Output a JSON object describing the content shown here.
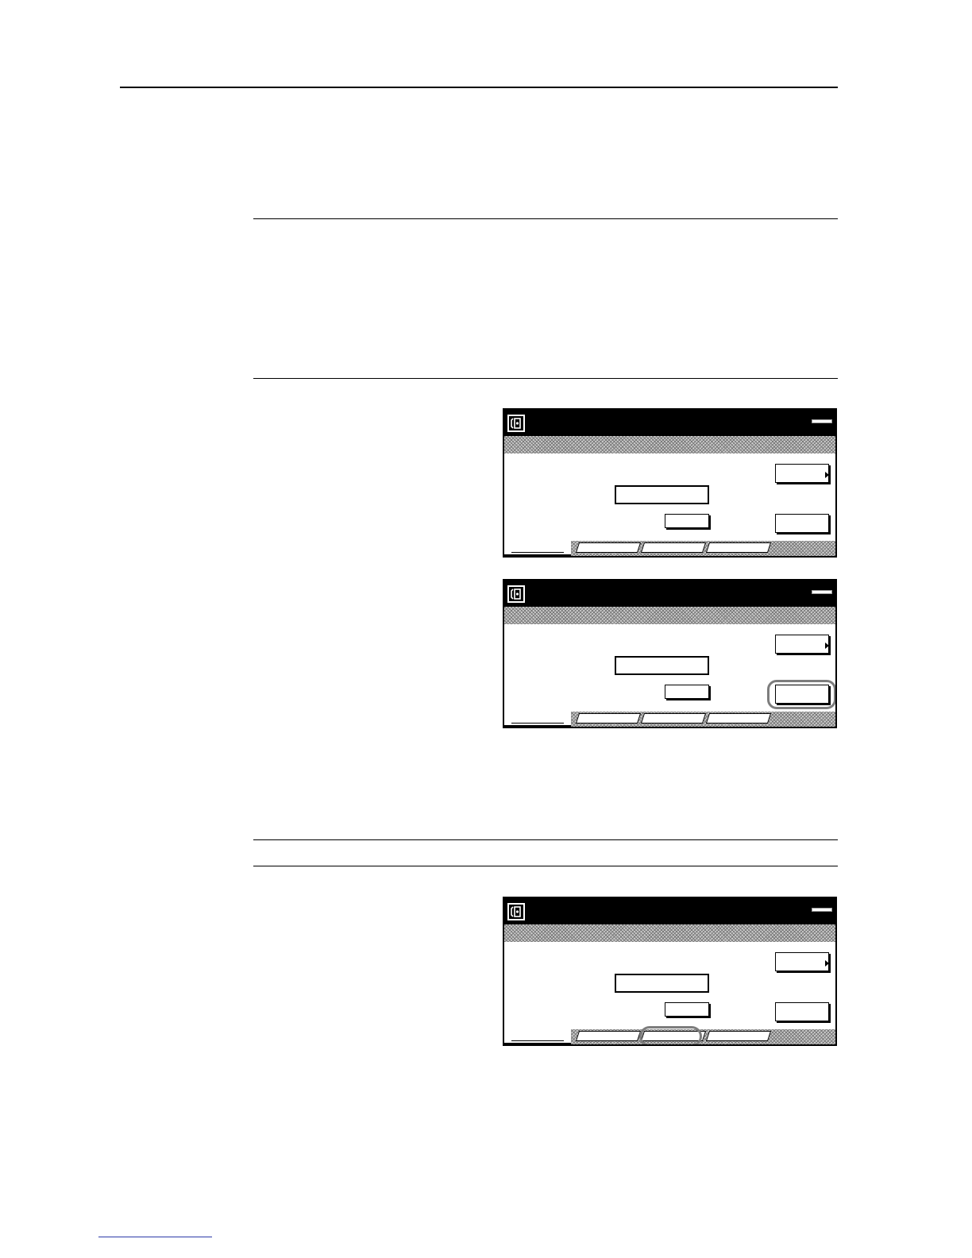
{
  "page": {
    "footer_link": ""
  },
  "panels": [
    {
      "id": "panel-1",
      "title": "",
      "status": "",
      "field_value": "",
      "buttons": {
        "upper_right": "",
        "lower_right": "",
        "small_center": ""
      },
      "tabs": [
        "",
        "",
        "",
        ""
      ],
      "highlight": "none"
    },
    {
      "id": "panel-2",
      "title": "",
      "status": "",
      "field_value": "",
      "buttons": {
        "upper_right": "",
        "lower_right": "",
        "small_center": ""
      },
      "tabs": [
        "",
        "",
        "",
        ""
      ],
      "highlight": "lower-right-button"
    },
    {
      "id": "panel-3",
      "title": "",
      "status": "",
      "field_value": "",
      "buttons": {
        "upper_right": "",
        "lower_right": "",
        "small_center": ""
      },
      "tabs": [
        "",
        "",
        "",
        ""
      ],
      "highlight": "third-tab"
    }
  ],
  "colors": {
    "titlebar": "#000000",
    "hatch": "#7a7a7a",
    "callout": "#7d7d7d",
    "footer_link": "#2b39a8"
  }
}
